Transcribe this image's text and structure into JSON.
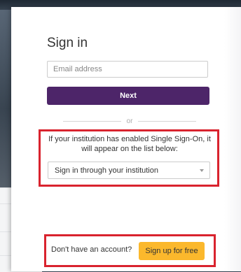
{
  "signin": {
    "title": "Sign in",
    "email_placeholder": "Email address",
    "next_label": "Next",
    "divider_label": "or"
  },
  "sso": {
    "description": "If your institution has enabled Single Sign-On, it will appear on the list below:",
    "select_label": "Sign in through your institution",
    "caret_icon": "chevron-down-icon"
  },
  "signup": {
    "prompt": "Don't have an account?",
    "button_label": "Sign up for free"
  },
  "colors": {
    "primary_button": "#4d2569",
    "signup_button": "#fbb82c",
    "highlight_border": "#d9232e"
  }
}
